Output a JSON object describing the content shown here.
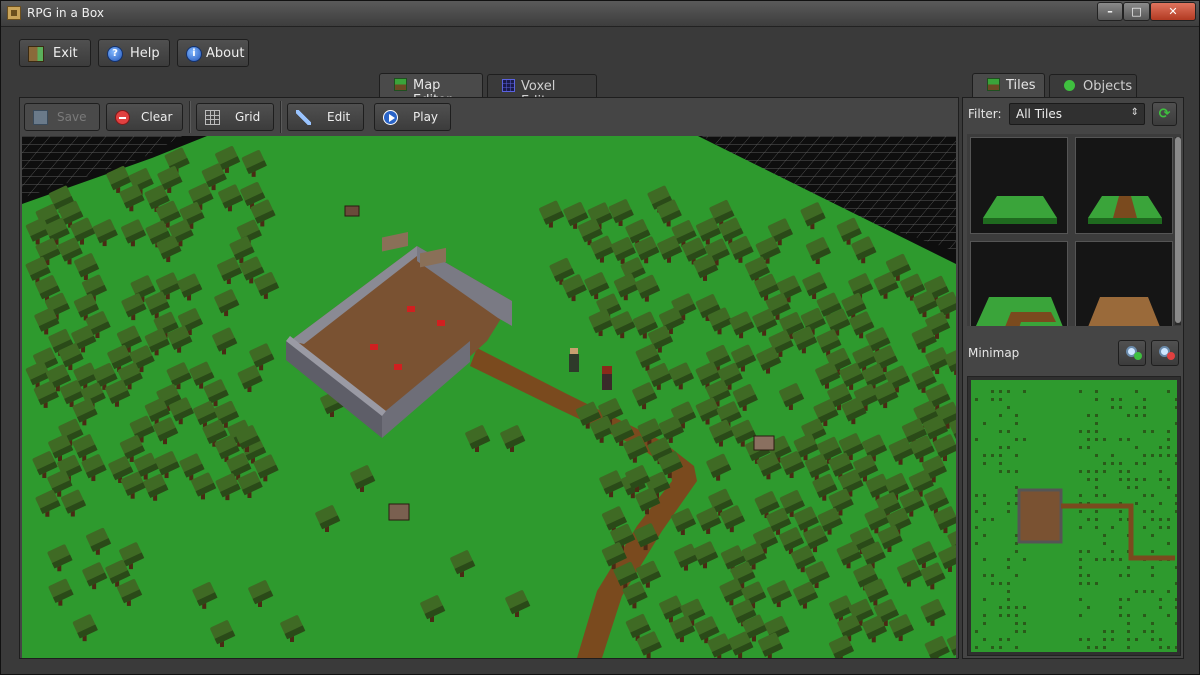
{
  "window": {
    "title": "RPG in a Box"
  },
  "toolbar": {
    "exit_label": "Exit",
    "help_label": "Help",
    "about_label": "About"
  },
  "editor_tabs": [
    {
      "label": "Map Editor",
      "active": true,
      "icon": "grass-block-icon"
    },
    {
      "label": "Voxel Editor",
      "active": false,
      "icon": "voxel-grid-icon"
    }
  ],
  "editor_toolbar": {
    "save_label": "Save",
    "save_enabled": false,
    "clear_label": "Clear",
    "grid_label": "Grid",
    "edit_label": "Edit",
    "play_label": "Play"
  },
  "palette_tabs": [
    {
      "label": "Tiles",
      "active": true,
      "icon": "grass-block-icon"
    },
    {
      "label": "Objects",
      "active": false,
      "icon": "tree-icon"
    }
  ],
  "filter": {
    "label": "Filter:",
    "selected": "All Tiles"
  },
  "tiles": [
    {
      "name": "grass-tile"
    },
    {
      "name": "grass-path-straight-tile"
    },
    {
      "name": "grass-path-corner-tile"
    },
    {
      "name": "wood-floor-tile"
    }
  ],
  "minimap": {
    "label": "Minimap"
  },
  "colors": {
    "grass": "#2e9a2e",
    "path": "#7a4a1e",
    "wall": "#6e6e78",
    "floor": "#7a5232",
    "tree": "#3f6a24",
    "trunk": "#4a2a14",
    "accent_red": "#d02020"
  }
}
